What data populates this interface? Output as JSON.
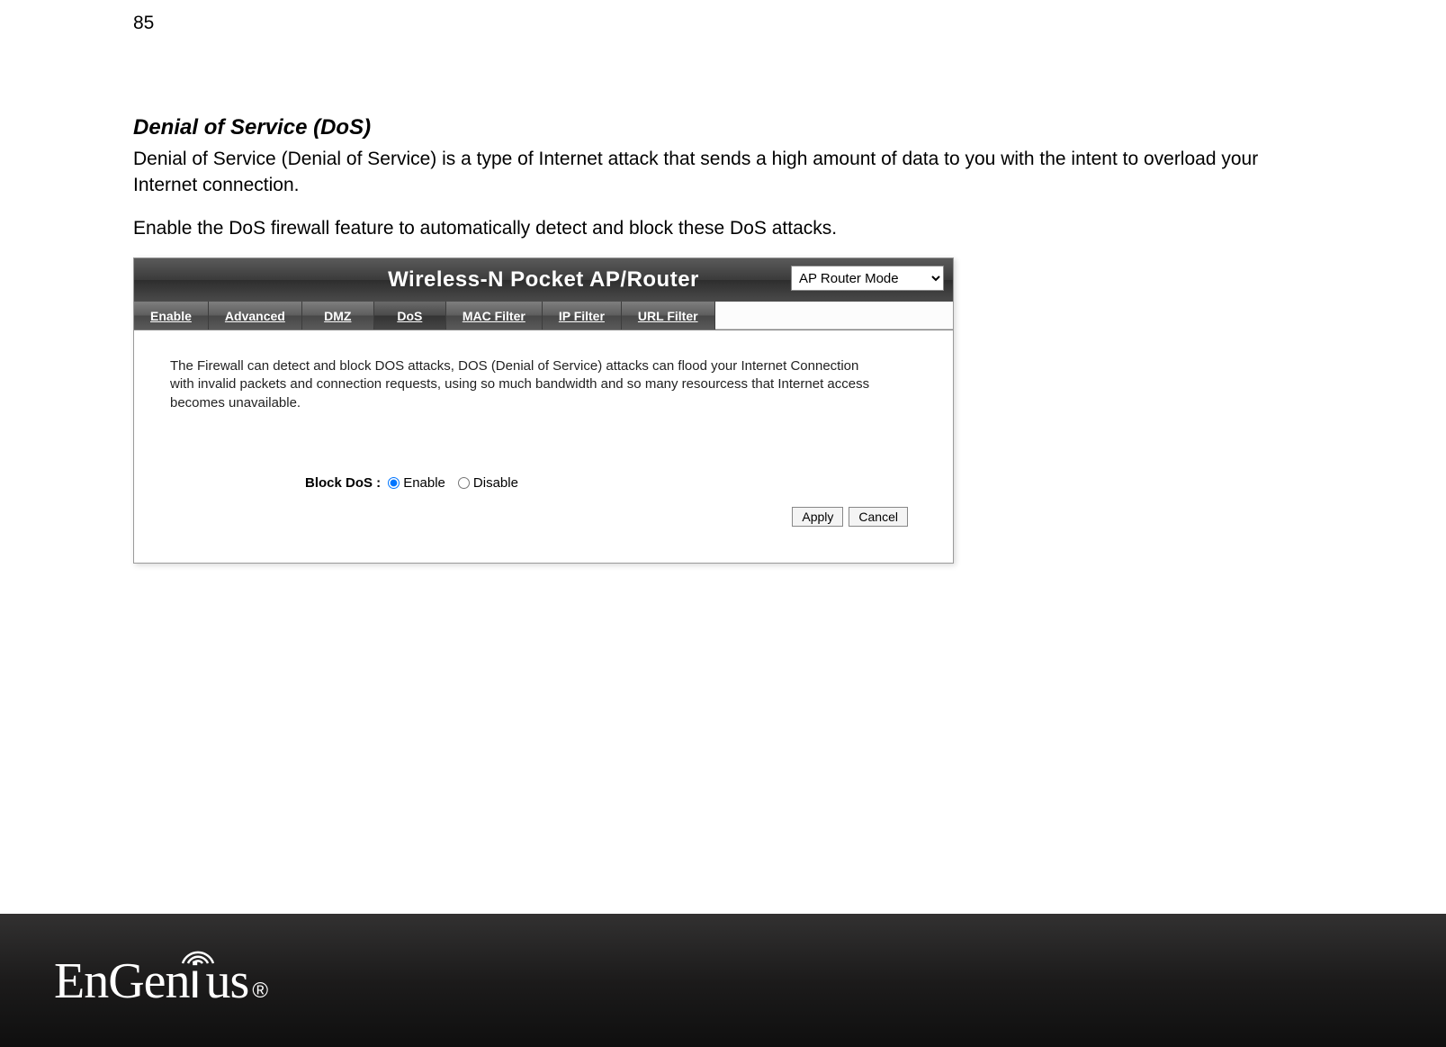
{
  "page_number": "85",
  "section": {
    "title": "Denial of Service (DoS)",
    "intro1": "Denial of Service (Denial of Service) is a type of Internet attack that sends a high amount of data to you with the intent to overload your Internet connection.",
    "intro2": "Enable the DoS firewall feature to automatically detect and block these DoS attacks."
  },
  "router": {
    "title": "Wireless-N Pocket AP/Router",
    "mode_selected": "AP Router Mode",
    "tabs": {
      "enable": "Enable",
      "advanced": "Advanced",
      "dmz": "DMZ",
      "dos": "DoS",
      "mac_filter": "MAC Filter",
      "ip_filter": "IP Filter",
      "url_filter": "URL Filter"
    },
    "description": "The Firewall can detect and block DOS attacks, DOS (Denial of Service) attacks can flood your Internet Connection with invalid packets and connection requests, using so much bandwidth and so many resourcess that Internet access becomes unavailable.",
    "form": {
      "label": "Block DoS :",
      "enable": "Enable",
      "disable": "Disable"
    },
    "buttons": {
      "apply": "Apply",
      "cancel": "Cancel"
    }
  },
  "footer": {
    "brand": "EnGenius",
    "reg": "®"
  }
}
